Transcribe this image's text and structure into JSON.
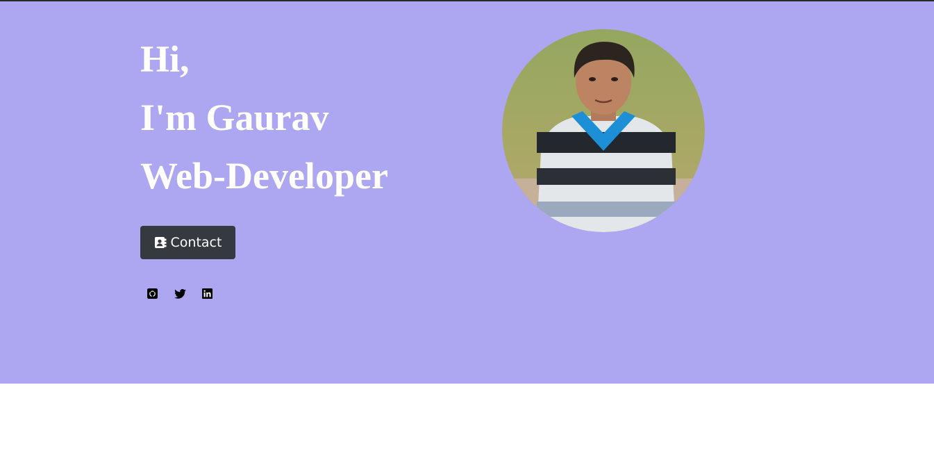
{
  "hero": {
    "greeting_line1": "Hi,",
    "greeting_line2": "I'm Gaurav",
    "greeting_line3": "Web-Developer",
    "contact_button_label": "Contact",
    "contact_icon": "address-book-icon",
    "social_links": [
      {
        "icon": "github-icon"
      },
      {
        "icon": "twitter-icon"
      },
      {
        "icon": "linkedin-icon"
      }
    ],
    "avatar": "profile-photo"
  },
  "colors": {
    "hero_background": "#ada6f1",
    "button_background": "#343a40",
    "text": "#ffffff"
  }
}
